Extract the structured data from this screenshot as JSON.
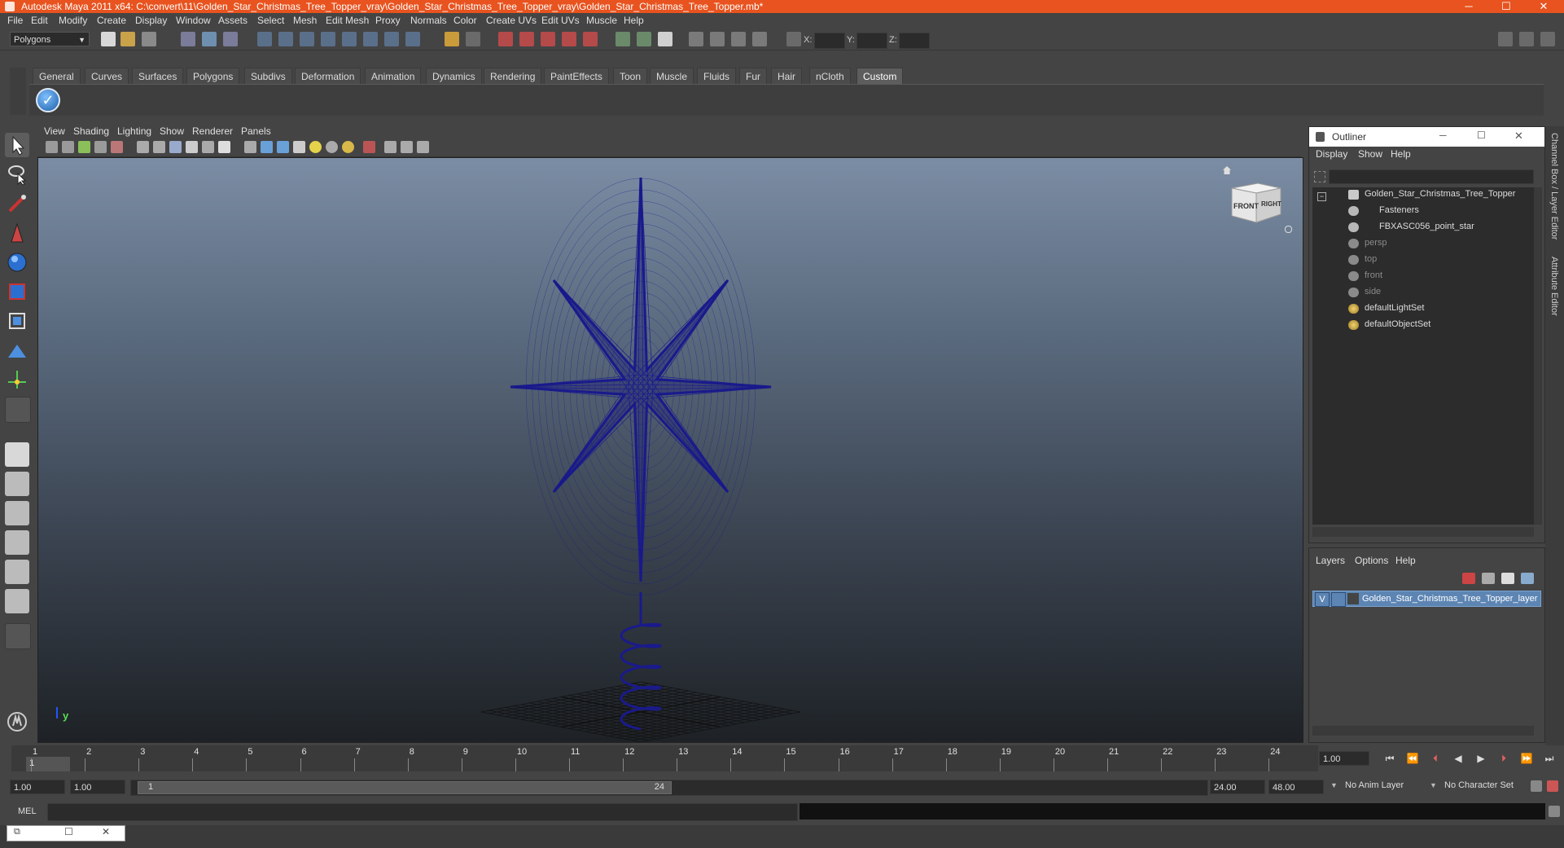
{
  "window": {
    "title": "Autodesk Maya 2011 x64: C:\\convert\\11\\Golden_Star_Christmas_Tree_Topper_vray\\Golden_Star_Christmas_Tree_Topper_vray\\Golden_Star_Christmas_Tree_Topper.mb*",
    "minimize": "─",
    "maximize": "☐",
    "close": "✕"
  },
  "menubar": [
    "File",
    "Edit",
    "Modify",
    "Create",
    "Display",
    "Window",
    "Assets",
    "Select",
    "Mesh",
    "Edit Mesh",
    "Proxy",
    "Normals",
    "Color",
    "Create UVs",
    "Edit UVs",
    "Muscle",
    "Help"
  ],
  "statusline": {
    "mode": "Polygons",
    "x_label": "X:",
    "y_label": "Y:",
    "z_label": "Z:"
  },
  "shelf": {
    "tabs": [
      "General",
      "Curves",
      "Surfaces",
      "Polygons",
      "Subdivs",
      "Deformation",
      "Animation",
      "Dynamics",
      "Rendering",
      "PaintEffects",
      "Toon",
      "Muscle",
      "Fluids",
      "Fur",
      "Hair",
      "nCloth",
      "Custom"
    ],
    "active": "Custom"
  },
  "viewport": {
    "menus": [
      "View",
      "Shading",
      "Lighting",
      "Show",
      "Renderer",
      "Panels"
    ],
    "viewcube": {
      "front": "FRONT",
      "right": "RIGHT"
    },
    "axis_label": "y",
    "wire_color": "#1a1a8c"
  },
  "outliner": {
    "title": "Outliner",
    "menus": [
      "Display",
      "Show",
      "Help"
    ],
    "items": [
      {
        "label": "Golden_Star_Christmas_Tree_Topper",
        "dim": false,
        "icon": "transform-icon"
      },
      {
        "label": "Fasteners",
        "dim": false,
        "icon": "mesh-icon"
      },
      {
        "label": "FBXASC056_point_star",
        "dim": false,
        "icon": "mesh-icon"
      },
      {
        "label": "persp",
        "dim": true,
        "icon": "camera-icon"
      },
      {
        "label": "top",
        "dim": true,
        "icon": "camera-icon"
      },
      {
        "label": "front",
        "dim": true,
        "icon": "camera-icon"
      },
      {
        "label": "side",
        "dim": true,
        "icon": "camera-icon"
      },
      {
        "label": "defaultLightSet",
        "dim": false,
        "icon": "set-icon"
      },
      {
        "label": "defaultObjectSet",
        "dim": false,
        "icon": "set-icon"
      }
    ]
  },
  "layers": {
    "menus": [
      "Layers",
      "Options",
      "Help"
    ],
    "layer": {
      "visible": "V",
      "name": "Golden_Star_Christmas_Tree_Topper_layer"
    }
  },
  "sidestrip": {
    "channel_box": "Channel Box / Layer Editor",
    "attribute_editor": "Attribute Editor"
  },
  "timeline": {
    "ticks": [
      "1",
      "2",
      "3",
      "4",
      "5",
      "6",
      "7",
      "8",
      "9",
      "10",
      "11",
      "12",
      "13",
      "14",
      "15",
      "16",
      "17",
      "18",
      "19",
      "20",
      "21",
      "22",
      "23",
      "24"
    ],
    "current_frame": "1",
    "current_time_field": "1.00",
    "start": "1.00",
    "start2": "1.00",
    "range_start": "1",
    "range_end": "24",
    "end": "24.00",
    "end2": "48.00",
    "anim_layer": "No Anim Layer",
    "character_set": "No Character Set"
  },
  "cmdline": {
    "label": "MEL"
  }
}
